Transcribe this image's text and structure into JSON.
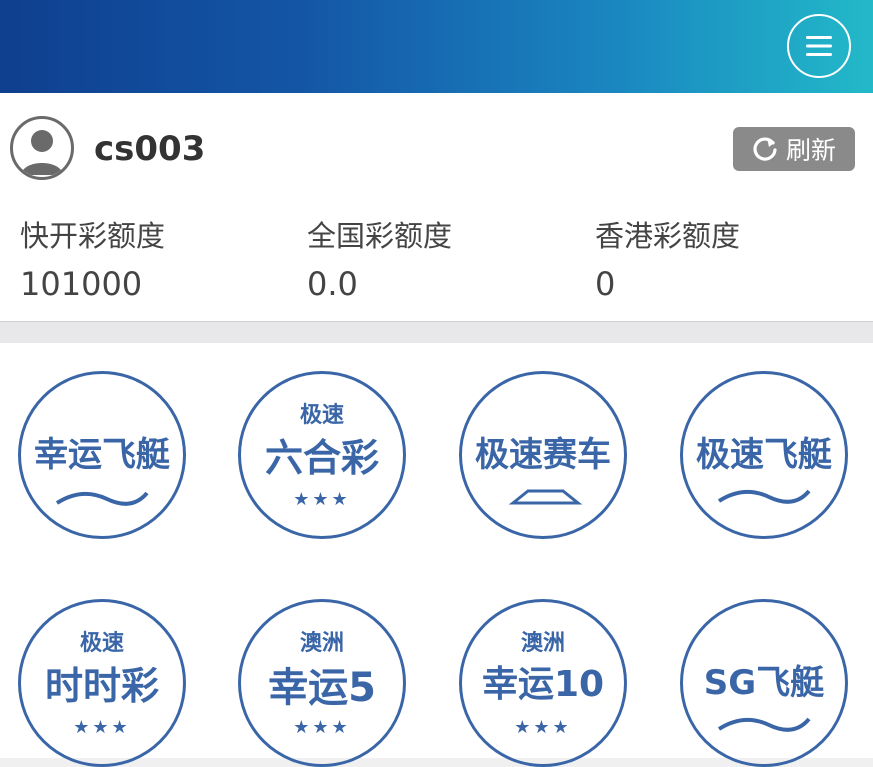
{
  "header": {
    "menu_icon": "hamburger-menu-icon"
  },
  "user": {
    "avatar_icon": "user-avatar-icon",
    "name": "cs003",
    "refresh_label": "刷新",
    "refresh_icon": "refresh-icon"
  },
  "quotas": [
    {
      "label": "快开彩额度",
      "value": "101000"
    },
    {
      "label": "全国彩额度",
      "value": "0.0"
    },
    {
      "label": "香港彩额度",
      "value": "0"
    }
  ],
  "games": [
    {
      "small": "",
      "label": "幸运飞艇",
      "stars": ""
    },
    {
      "small": "极速",
      "label": "六合彩",
      "stars": "★★★"
    },
    {
      "small": "",
      "label": "极速赛车",
      "stars": ""
    },
    {
      "small": "",
      "label": "极速飞艇",
      "stars": ""
    },
    {
      "small": "极速",
      "label": "时时彩",
      "stars": "★★★"
    },
    {
      "small": "澳洲",
      "label": "幸运5",
      "stars": "★★★"
    },
    {
      "small": "澳洲",
      "label": "幸运10",
      "stars": "★★★"
    },
    {
      "small": "",
      "label": "SG飞艇",
      "stars": ""
    }
  ],
  "colors": {
    "accent": "#3a66a8",
    "header_start": "#0f3f8f",
    "header_end": "#22b9c9",
    "button_gray": "#8a8a8a"
  }
}
